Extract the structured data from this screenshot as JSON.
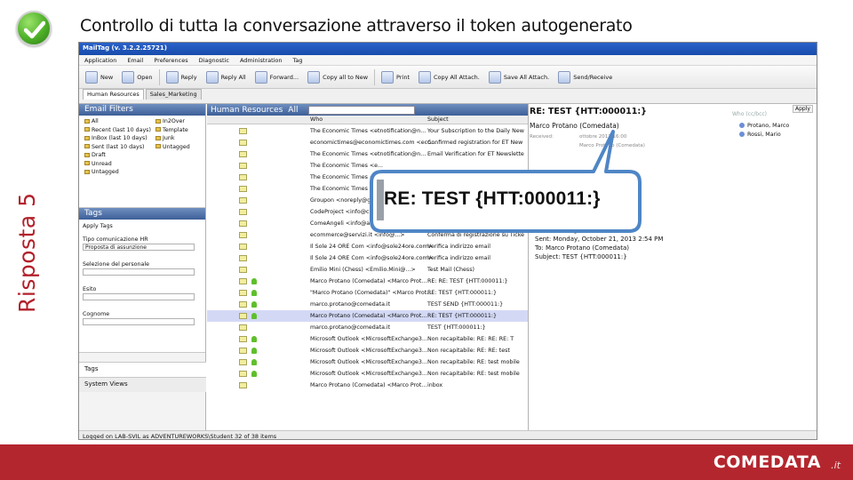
{
  "slide": {
    "title": "Controllo di tutta la conversazione attraverso il token autogenerato",
    "side_label": "Risposta 5",
    "brand": "COMEDATA",
    "brand_suffix": ".it"
  },
  "app": {
    "window_title": "MailTag (v. 3.2.2.25721)",
    "menu": [
      "Application",
      "Email",
      "Preferences",
      "Diagnostic",
      "Administration",
      "Tag"
    ],
    "toolbar": [
      "New",
      "Open",
      "Reply",
      "Reply All",
      "Forward...",
      "Copy all to New",
      "Print",
      "Copy All Attach.",
      "Save All Attach.",
      "Send/Receive"
    ],
    "tabs": [
      "Human Resources",
      "Sales_Marketing"
    ],
    "email_filters": {
      "title": "Email Filters",
      "col1": [
        "All",
        "Recent (last 10 days)",
        "InBox (last 10 days)",
        "Sent (last 10 days)",
        "Draft",
        "Unread",
        "Untagged"
      ],
      "col2": [
        "In2Over",
        "Template",
        "Junk",
        "Untagged"
      ]
    },
    "tags": {
      "title": "Tags",
      "apply": "Apply Tags",
      "fields": [
        {
          "label": "Tipo comunicazione HR",
          "value": "Proposta di assunzione"
        },
        {
          "label": "Selezione del personale",
          "value": ""
        },
        {
          "label": "Esito",
          "value": ""
        },
        {
          "label": "Cognome",
          "value": ""
        }
      ]
    },
    "nav": [
      "Tags",
      "System Views"
    ],
    "list": {
      "title": "Human Resources",
      "filter": "All",
      "columns": [
        "Who",
        "Subject"
      ],
      "rows": [
        {
          "who": "The Economic Times <etnotification@n...",
          "subject": "Your Subscription to the Daily New",
          "tag": false,
          "sel": false
        },
        {
          "who": "economictimes@economictimes.com <eco...",
          "subject": "Confirmed registration for ET New",
          "tag": false,
          "sel": false
        },
        {
          "who": "The Economic Times <etnotification@n...",
          "subject": "Email Verification for ET Newslette",
          "tag": false,
          "sel": false
        },
        {
          "who": "The Economic Times <e...",
          "subject": "",
          "tag": false,
          "sel": false
        },
        {
          "who": "The Economic Times <e...",
          "subject": "",
          "tag": false,
          "sel": false
        },
        {
          "who": "The Economic Times <e...",
          "subject": "",
          "tag": false,
          "sel": false
        },
        {
          "who": "Groupon <noreply@gr...",
          "subject": "",
          "tag": false,
          "sel": false
        },
        {
          "who": "CodeProject <info@c...",
          "subject": "",
          "tag": false,
          "sel": false
        },
        {
          "who": "ComeAngeli <info@angeli.com>",
          "subject": "ComeAngeli | ComeAngeli | Email",
          "tag": false,
          "sel": false
        },
        {
          "who": "ecommerce@servizi.it <info@...>",
          "subject": "Conferma di registrazione su Ticke",
          "tag": false,
          "sel": false
        },
        {
          "who": "Il Sole 24 ORE Com <info@sole24ore.com>",
          "subject": "Verifica indirizzo email",
          "tag": false,
          "sel": false
        },
        {
          "who": "Il Sole 24 ORE Com <info@sole24ore.com>",
          "subject": "Verifica indirizzo email",
          "tag": false,
          "sel": false
        },
        {
          "who": "Emilio Mini (Chess) <Emilio.Mini@...>",
          "subject": "Test Mail (Chess)",
          "tag": false,
          "sel": false
        },
        {
          "who": "Marco Protano (Comedata) <Marco Prot...",
          "subject": "RE: RE: TEST {HTT:000011:}",
          "tag": true,
          "sel": false
        },
        {
          "who": "\"Marco Protano (Comedata)\" <Marco Prot...",
          "subject": "RE: TEST {HTT:000011:}",
          "tag": true,
          "sel": false
        },
        {
          "who": "marco.protano@comedata.it",
          "subject": "TEST SEND {HTT:000011:}",
          "tag": true,
          "sel": false
        },
        {
          "who": "Marco Protano (Comedata) <Marco Prot...",
          "subject": "RE: TEST {HTT:000011:}",
          "tag": true,
          "sel": true
        },
        {
          "who": "marco.protano@comedata.it",
          "subject": "TEST {HTT:000011:}",
          "tag": false,
          "sel": false
        },
        {
          "who": "Microsoft Outlook <MicrosoftExchange3...",
          "subject": "Non recapitabile: RE: RE: RE: T",
          "tag": true,
          "sel": false
        },
        {
          "who": "Microsoft Outlook <MicrosoftExchange3...",
          "subject": "Non recapitabile: RE: RE: test",
          "tag": true,
          "sel": false
        },
        {
          "who": "Microsoft Outlook <MicrosoftExchange3...",
          "subject": "Non recapitabile: RE: test mobile",
          "tag": true,
          "sel": false
        },
        {
          "who": "Microsoft Outlook <MicrosoftExchange3...",
          "subject": "Non recapitabile: RE: test mobile",
          "tag": true,
          "sel": false
        },
        {
          "who": "Marco Protano (Comedata) <Marco Prot...",
          "subject": "inbox",
          "tag": false,
          "sel": false
        }
      ]
    },
    "preview": {
      "subject": "RE: TEST {HTT:000011:}",
      "from": "Marco Protano (Comedata)",
      "received": "Received:",
      "sent_short": "ottobre 2013 16:00",
      "to_short": "Marco Protano (Comedata)",
      "with_label": "Who (cc/bcc)",
      "recipients": [
        "Protano, Marco",
        "Rossi, Mario"
      ],
      "apply": "Apply",
      "header": [
        "From: MailTagDemo1",
        "Sent: Monday, October 21, 2013 2:54 PM",
        "To: Marco Protano (Comedata)",
        "Subject: TEST {HTT:000011:}"
      ]
    },
    "status": "Logged on LAB-SVIL as ADVENTUREWORKS\\Student  32 of 38 items"
  },
  "callout": {
    "text": "RE: TEST {HTT:000011:}"
  }
}
